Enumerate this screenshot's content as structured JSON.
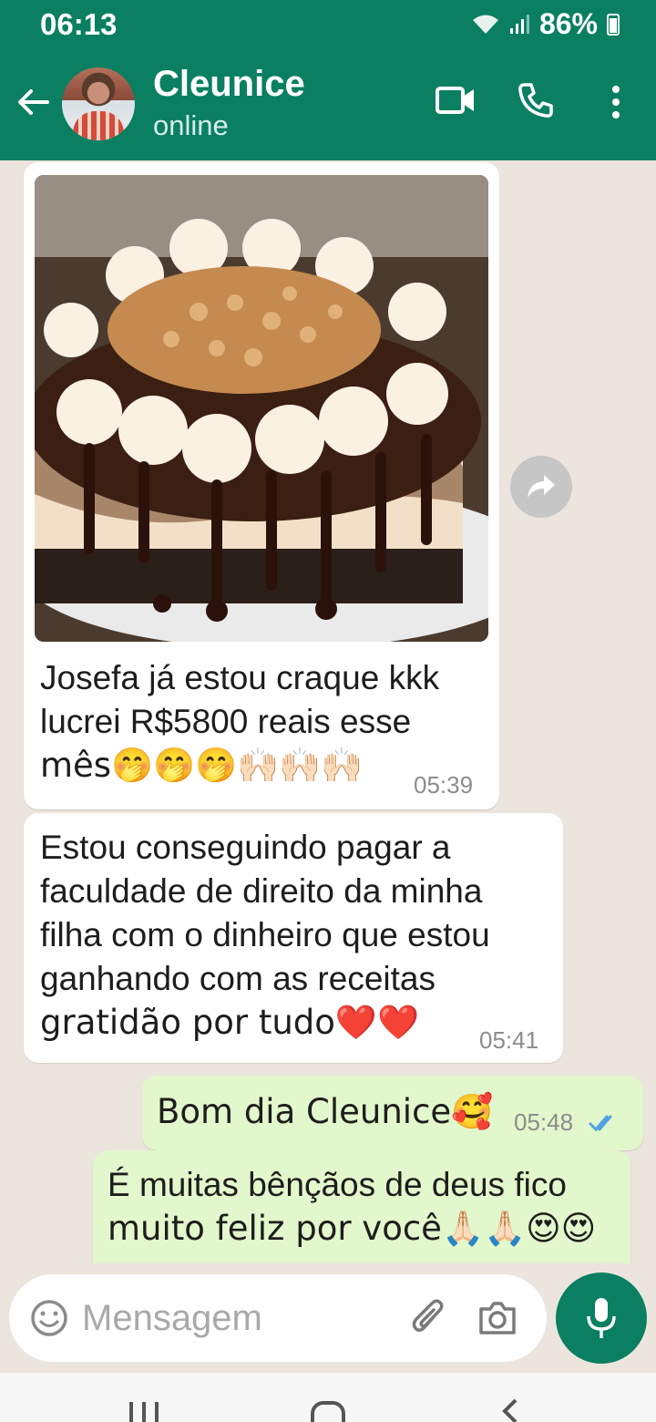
{
  "status": {
    "time": "06:13",
    "battery": "86%"
  },
  "header": {
    "contact_name": "Cleunice",
    "presence": "online"
  },
  "messages": [
    {
      "dir": "in",
      "has_image": true,
      "text_lines": [
        "Josefa já estou craque kkk",
        "lucrei R$5800 reais esse",
        "mês🤭🤭🤭🙌🏻🙌🏻🙌🏻"
      ],
      "time": "05:39"
    },
    {
      "dir": "in",
      "text_lines": [
        "Estou conseguindo pagar a",
        "faculdade de direito da minha",
        "filha com o dinheiro que estou",
        "ganhando com as receitas",
        "gratidão por tudo❤️❤️"
      ],
      "time": "05:41"
    },
    {
      "dir": "out",
      "text_lines": [
        "Bom dia Cleunice🥰"
      ],
      "time": "05:48",
      "read": true
    },
    {
      "dir": "out",
      "text_lines": [
        "É muitas bênçãos de deus fico",
        "muito feliz por você🙏🏻🙏🏻😍😍"
      ]
    }
  ],
  "composer": {
    "placeholder": "Mensagem"
  },
  "colors": {
    "header": "#0a7f62",
    "chat_bg": "#ece5dd",
    "incoming": "#ffffff",
    "outgoing": "#e2f7cb",
    "read_tick": "#4fa3e0"
  },
  "icons": [
    "back-arrow-icon",
    "video-call-icon",
    "phone-icon",
    "more-vert-icon",
    "forward-icon",
    "emoji-icon",
    "attach-icon",
    "camera-icon",
    "mic-icon"
  ]
}
